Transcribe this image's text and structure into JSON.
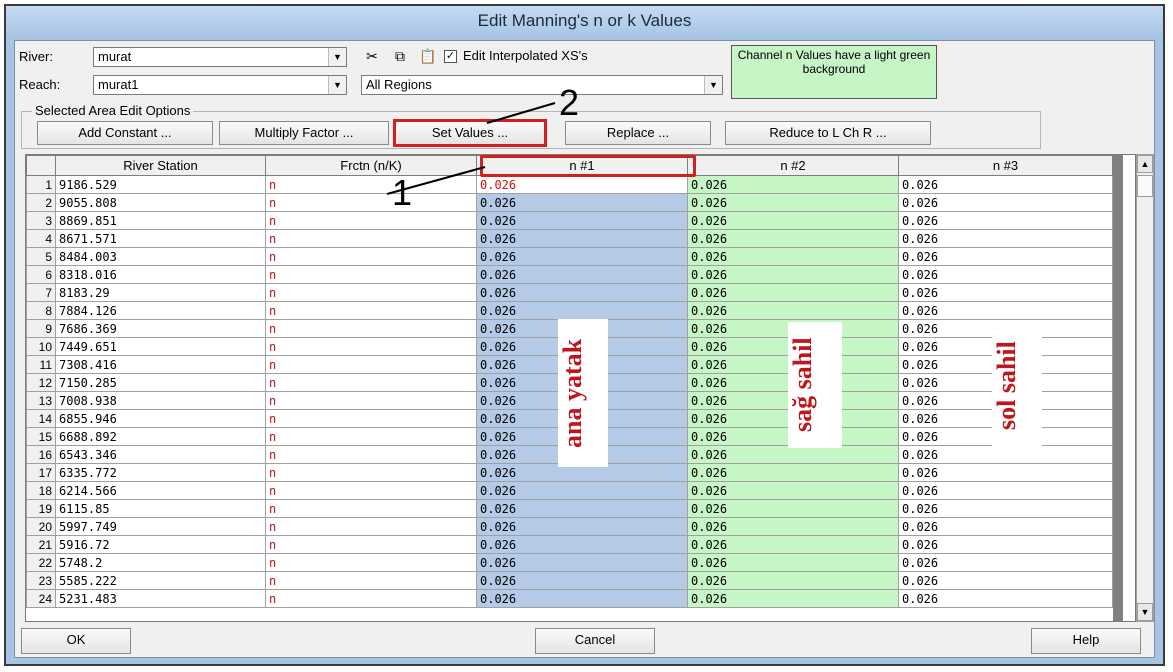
{
  "window": {
    "title": "Edit Manning's n or k Values"
  },
  "river": {
    "label": "River:",
    "value": "murat"
  },
  "reach": {
    "label": "Reach:",
    "value": "murat1"
  },
  "region": {
    "value": "All Regions"
  },
  "toolbar": {
    "cut_icon": "scissors-icon",
    "copy_icon": "copy-icon",
    "paste_icon": "paste-icon",
    "edit_interp_label": "Edit Interpolated XS's",
    "edit_interp_checked": "✓"
  },
  "note": "Channel n Values have a light green background",
  "options": {
    "legend": "Selected Area Edit Options",
    "add_constant": "Add Constant ...",
    "multiply": "Multiply Factor ...",
    "set_values": "Set Values ...",
    "replace": "Replace ...",
    "reduce": "Reduce to L Ch R ..."
  },
  "table": {
    "headers": [
      "River Station",
      "Frctn (n/K)",
      "n #1",
      "n #2",
      "n #3"
    ],
    "rows": [
      {
        "num": "1",
        "station": "9186.529",
        "frctn": "n",
        "n1": "0.026",
        "n2": "0.026",
        "n3": "0.026"
      },
      {
        "num": "2",
        "station": "9055.808",
        "frctn": "n",
        "n1": "0.026",
        "n2": "0.026",
        "n3": "0.026"
      },
      {
        "num": "3",
        "station": "8869.851",
        "frctn": "n",
        "n1": "0.026",
        "n2": "0.026",
        "n3": "0.026"
      },
      {
        "num": "4",
        "station": "8671.571",
        "frctn": "n",
        "n1": "0.026",
        "n2": "0.026",
        "n3": "0.026"
      },
      {
        "num": "5",
        "station": "8484.003",
        "frctn": "n",
        "n1": "0.026",
        "n2": "0.026",
        "n3": "0.026"
      },
      {
        "num": "6",
        "station": "8318.016",
        "frctn": "n",
        "n1": "0.026",
        "n2": "0.026",
        "n3": "0.026"
      },
      {
        "num": "7",
        "station": "8183.29",
        "frctn": "n",
        "n1": "0.026",
        "n2": "0.026",
        "n3": "0.026"
      },
      {
        "num": "8",
        "station": "7884.126",
        "frctn": "n",
        "n1": "0.026",
        "n2": "0.026",
        "n3": "0.026"
      },
      {
        "num": "9",
        "station": "7686.369",
        "frctn": "n",
        "n1": "0.026",
        "n2": "0.026",
        "n3": "0.026"
      },
      {
        "num": "10",
        "station": "7449.651",
        "frctn": "n",
        "n1": "0.026",
        "n2": "0.026",
        "n3": "0.026"
      },
      {
        "num": "11",
        "station": "7308.416",
        "frctn": "n",
        "n1": "0.026",
        "n2": "0.026",
        "n3": "0.026"
      },
      {
        "num": "12",
        "station": "7150.285",
        "frctn": "n",
        "n1": "0.026",
        "n2": "0.026",
        "n3": "0.026"
      },
      {
        "num": "13",
        "station": "7008.938",
        "frctn": "n",
        "n1": "0.026",
        "n2": "0.026",
        "n3": "0.026"
      },
      {
        "num": "14",
        "station": "6855.946",
        "frctn": "n",
        "n1": "0.026",
        "n2": "0.026",
        "n3": "0.026"
      },
      {
        "num": "15",
        "station": "6688.892",
        "frctn": "n",
        "n1": "0.026",
        "n2": "0.026",
        "n3": "0.026"
      },
      {
        "num": "16",
        "station": "6543.346",
        "frctn": "n",
        "n1": "0.026",
        "n2": "0.026",
        "n3": "0.026"
      },
      {
        "num": "17",
        "station": "6335.772",
        "frctn": "n",
        "n1": "0.026",
        "n2": "0.026",
        "n3": "0.026"
      },
      {
        "num": "18",
        "station": "6214.566",
        "frctn": "n",
        "n1": "0.026",
        "n2": "0.026",
        "n3": "0.026"
      },
      {
        "num": "19",
        "station": "6115.85",
        "frctn": "n",
        "n1": "0.026",
        "n2": "0.026",
        "n3": "0.026"
      },
      {
        "num": "20",
        "station": "5997.749",
        "frctn": "n",
        "n1": "0.026",
        "n2": "0.026",
        "n3": "0.026"
      },
      {
        "num": "21",
        "station": "5916.72",
        "frctn": "n",
        "n1": "0.026",
        "n2": "0.026",
        "n3": "0.026"
      },
      {
        "num": "22",
        "station": "5748.2",
        "frctn": "n",
        "n1": "0.026",
        "n2": "0.026",
        "n3": "0.026"
      },
      {
        "num": "23",
        "station": "5585.222",
        "frctn": "n",
        "n1": "0.026",
        "n2": "0.026",
        "n3": "0.026"
      },
      {
        "num": "24",
        "station": "5231.483",
        "frctn": "n",
        "n1": "0.026",
        "n2": "0.026",
        "n3": "0.026"
      }
    ]
  },
  "annotations": {
    "marker1": "1",
    "marker2": "2",
    "ana_yatak": "ana yatak",
    "sag_sahil": "sağ sahil",
    "sol_sahil": "sol sahil"
  },
  "buttons": {
    "ok": "OK",
    "cancel": "Cancel",
    "help": "Help"
  },
  "colors": {
    "n1_background": "#b5cae6",
    "channel_background": "#c6f5c6",
    "annotation_red": "#c0151b"
  }
}
